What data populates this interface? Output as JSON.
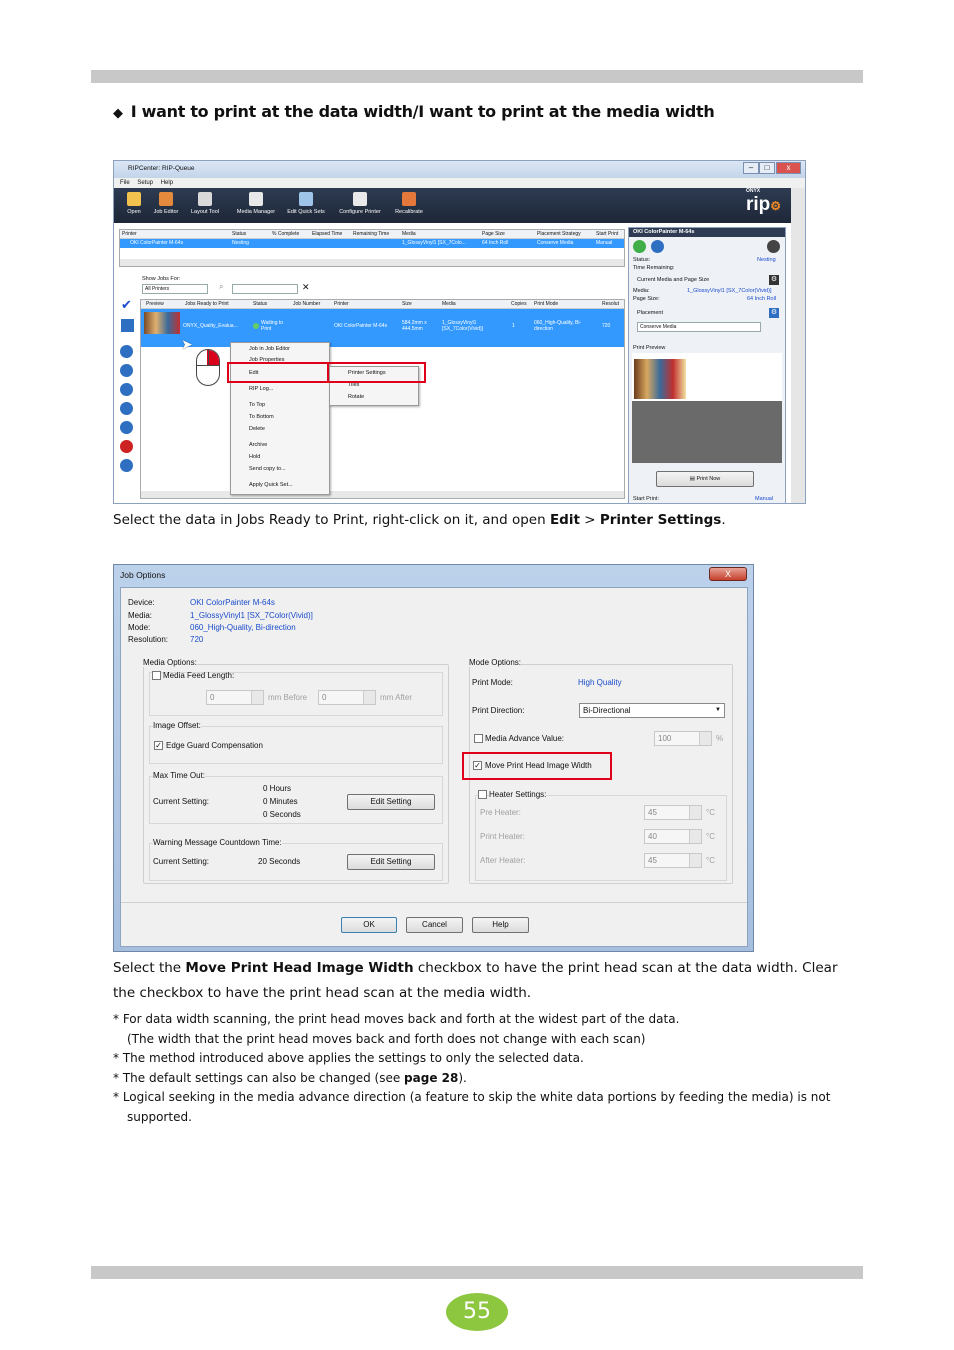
{
  "heading": "I want to print at the data width/I want to print at the media width",
  "shot1": {
    "title": "RIPCenter: RIP-Queue",
    "menus": [
      "File",
      "Setup",
      "Help"
    ],
    "tools": [
      "Open",
      "Job Editor",
      "Layout Tool",
      "Media Manager",
      "Edit Quick Sets",
      "Configure Printer",
      "Recalibrate"
    ],
    "brand": "rip",
    "brand_small": "ONYX",
    "printer_cols": [
      "Printer",
      "Status",
      "% Complete",
      "Elapsed Time",
      "Remaining Time",
      "Media",
      "Page Size",
      "Placement Strategy",
      "Start Print"
    ],
    "printer_row": [
      "OKI ColorPainter M-64s",
      "Nesting",
      "1_GlossyVinyl1 [SX_7Colo...",
      "64 Inch Roll",
      "Conserve Media",
      "Manual"
    ],
    "show_jobs_label": "Show Jobs For:",
    "show_jobs_value": "All Printers",
    "job_cols": [
      "Preview",
      "Jobs Ready to Print",
      "Status",
      "Job Number",
      "Printer",
      "Size",
      "Media",
      "Copies",
      "Print Mode",
      "Resolut"
    ],
    "job_row": [
      "ONYX_Quality_Evalua...",
      "Waiting to Print",
      "OKI ColorPainter M-64s",
      "584.2mm x 444.5mm",
      "1_GlossyVinyl1 [SX_7Color(Vivid)]",
      "1",
      "060_High-Quality, Bi-direction",
      "720"
    ],
    "context_menu": [
      "Job in Job Editor",
      "Job Properties",
      "Edit",
      "RIP Log...",
      "To Top",
      "To Bottom",
      "Delete",
      "Archive",
      "Hold",
      "Send copy to...",
      "Apply Quick Set..."
    ],
    "submenu": [
      "Printer Settings",
      "Tiles",
      "Rotate"
    ],
    "side": {
      "printer": "OKI ColorPainter M-64s",
      "status_label": "Status:",
      "status_value": "Nesting",
      "time_label": "Time Remaining:",
      "cur_media_label": "Current Media and Page Size",
      "media_label": "Media:",
      "media_value": "1_GlossyVinyl1 [SX_7Color(Vivid)]",
      "page_label": "Page Size:",
      "page_value": "64 Inch Roll",
      "placement_label": "Placement",
      "placement_value": "Conserve Media",
      "preview_label": "Print Preview",
      "print_now": "Print Now",
      "start_label": "Start Print:",
      "start_value": "Manual"
    }
  },
  "caption1": {
    "pre": "Select the data in Jobs Ready to Print, right-click on it, and open ",
    "b1": "Edit",
    "mid": " > ",
    "b2": "Printer Settings",
    "post": "."
  },
  "shot2": {
    "title": "Job Options",
    "close": "X",
    "device_label": "Device:",
    "device": "OKI ColorPainter M-64s",
    "media_label": "Media:",
    "media": "1_GlossyVinyl1 [SX_7Color(Vivid)]",
    "mode_label": "Mode:",
    "mode": "060_High-Quality, Bi-direction",
    "res_label": "Resolution:",
    "res": "720",
    "media_options": "Media Options:",
    "feed_length": "Media Feed Length:",
    "before_val": "0",
    "before_unit": "mm Before",
    "after_val": "0",
    "after_unit": "mm After",
    "image_offset": "Image Offset:",
    "edge_guard": "Edge Guard Compensation",
    "max_time": "Max Time Out:",
    "current_setting": "Current Setting:",
    "hours": "0  Hours",
    "minutes": "0  Minutes",
    "seconds": "0  Seconds",
    "edit_setting": "Edit Setting",
    "warning": "Warning Message Countdown Time:",
    "countdown": "20  Seconds",
    "mode_options": "Mode Options:",
    "print_mode_label": "Print Mode:",
    "print_mode": "High Quality",
    "print_dir_label": "Print Direction:",
    "print_dir": "Bi-Directional",
    "advance": "Media Advance Value:",
    "advance_val": "100",
    "pct": "%",
    "move_head": "Move Print Head Image Width",
    "heater": "Heater Settings:",
    "pre_heater": "Pre Heater:",
    "print_heater": "Print Heater:",
    "after_heater": "After Heater:",
    "pre_val": "45",
    "print_val": "40",
    "after_heater_val": "45",
    "deg": "°C",
    "ok": "OK",
    "cancel": "Cancel",
    "help": "Help"
  },
  "caption2": {
    "pre": "Select the ",
    "b": "Move Print Head Image Width",
    "post": " checkbox to have the print head scan at the data width. Clear the checkbox to have the print head scan at the media width."
  },
  "notes": {
    "n1a": "*  For data width scanning, the print head moves back and forth at the widest part of the data.",
    "n1b": "(The width that the print head moves back and forth does not change with each scan)",
    "n2": "*  The method introduced above applies the settings to only the selected data.",
    "n3_pre": "*  The default settings can also be changed (see ",
    "n3_b": "page 28",
    "n3_post": ").",
    "n4": "*  Logical seeking in the media advance direction (a feature to skip the white data portions by feeding the media) is not supported."
  },
  "page_number": "55"
}
